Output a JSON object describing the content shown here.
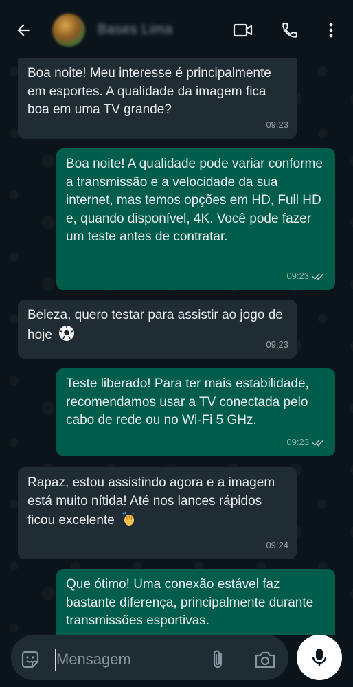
{
  "header": {
    "contact_name": "Bases Lima",
    "icons": [
      "arrow-back-icon",
      "avatar",
      "videocam-icon",
      "phone-icon",
      "more-vert-icon"
    ]
  },
  "messages": [
    {
      "direction": "in",
      "text": "Boa noite! Meu interesse é principalmente em esportes. A qualidade da imagem fica boa em uma TV grande?",
      "time": "09:23"
    },
    {
      "direction": "out",
      "text": "Boa noite! A qualidade pode variar conforme a transmissão e a velocidade da sua internet, mas temos opções em HD, Full HD e, quando disponível, 4K. Você pode fazer um teste antes de contratar.",
      "time": "09:23",
      "status": "read"
    },
    {
      "direction": "in",
      "text": "Beleza, quero testar para assistir ao jogo de hoje",
      "emoji": "soccer-ball-icon",
      "time": "09:23"
    },
    {
      "direction": "out",
      "text": "Teste liberado! Para ter mais estabilidade, recomendamos usar a TV conectada pelo cabo de rede ou no Wi-Fi 5 GHz.",
      "time": "09:23",
      "status": "read"
    },
    {
      "direction": "in",
      "text": "Rapaz, estou assistindo agora e a imagem está muito nítida! Até nos lances rápidos ficou excelente",
      "emoji": "clapping-hands-icon",
      "time": "09:24"
    },
    {
      "direction": "out",
      "text": "Que ótimo! Uma conexão estável faz bastante diferença, principalmente durante transmissões esportivas.",
      "time": ""
    }
  ],
  "composer": {
    "placeholder": "Mensagem"
  },
  "colors": {
    "background": "#0b141a",
    "incoming_bubble": "#202c33",
    "outgoing_bubble": "#005c4b",
    "read_ticks": "#8696a0",
    "mic_button": "#ffffff"
  }
}
